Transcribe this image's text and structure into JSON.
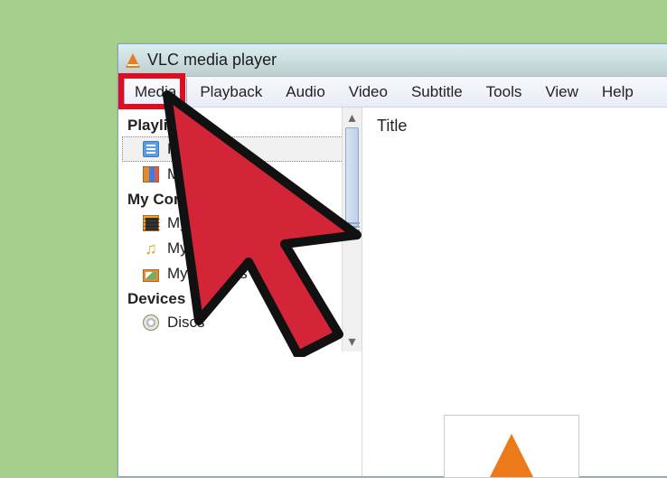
{
  "window": {
    "title": "VLC media player"
  },
  "menu": {
    "items": [
      "Media",
      "Playback",
      "Audio",
      "Video",
      "Subtitle",
      "Tools",
      "View",
      "Help"
    ],
    "highlighted_index": 0
  },
  "sidebar": {
    "sections": [
      {
        "header": "Playlist",
        "items": [
          {
            "label": "Playlist",
            "icon": "playlist-icon",
            "selected": true
          },
          {
            "label": "Media Library",
            "icon": "library-icon"
          }
        ]
      },
      {
        "header": "My Computer",
        "items": [
          {
            "label": "My Videos",
            "icon": "video-icon"
          },
          {
            "label": "My Music",
            "icon": "music-icon"
          },
          {
            "label": "My Pictures",
            "icon": "pictures-icon"
          }
        ]
      },
      {
        "header": "Devices",
        "items": [
          {
            "label": "Discs",
            "icon": "disc-icon"
          }
        ]
      }
    ]
  },
  "main": {
    "columns": [
      "Title"
    ]
  },
  "annotation": {
    "highlight_target": "menu-media",
    "cursor": "large-red-pointer"
  }
}
